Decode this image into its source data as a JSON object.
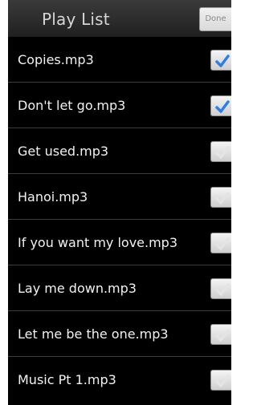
{
  "header": {
    "title": "Play List",
    "done_label": "Done"
  },
  "playlist": [
    {
      "label": "Copies.mp3",
      "checked": true
    },
    {
      "label": "Don't let go.mp3",
      "checked": true
    },
    {
      "label": "Get used.mp3",
      "checked": false
    },
    {
      "label": "Hanoi.mp3",
      "checked": false
    },
    {
      "label": "If you want my love.mp3",
      "checked": false
    },
    {
      "label": "Lay me down.mp3",
      "checked": false
    },
    {
      "label": "Let me be the one.mp3",
      "checked": false
    },
    {
      "label": "Music Pt 1.mp3",
      "checked": false
    }
  ],
  "colors": {
    "check_active": "#2f7ee6",
    "check_inactive": "#e4e4e4",
    "background": "#000000",
    "text": "#f2f2f2"
  },
  "icons": {
    "checkmark": "checkmark-icon"
  }
}
